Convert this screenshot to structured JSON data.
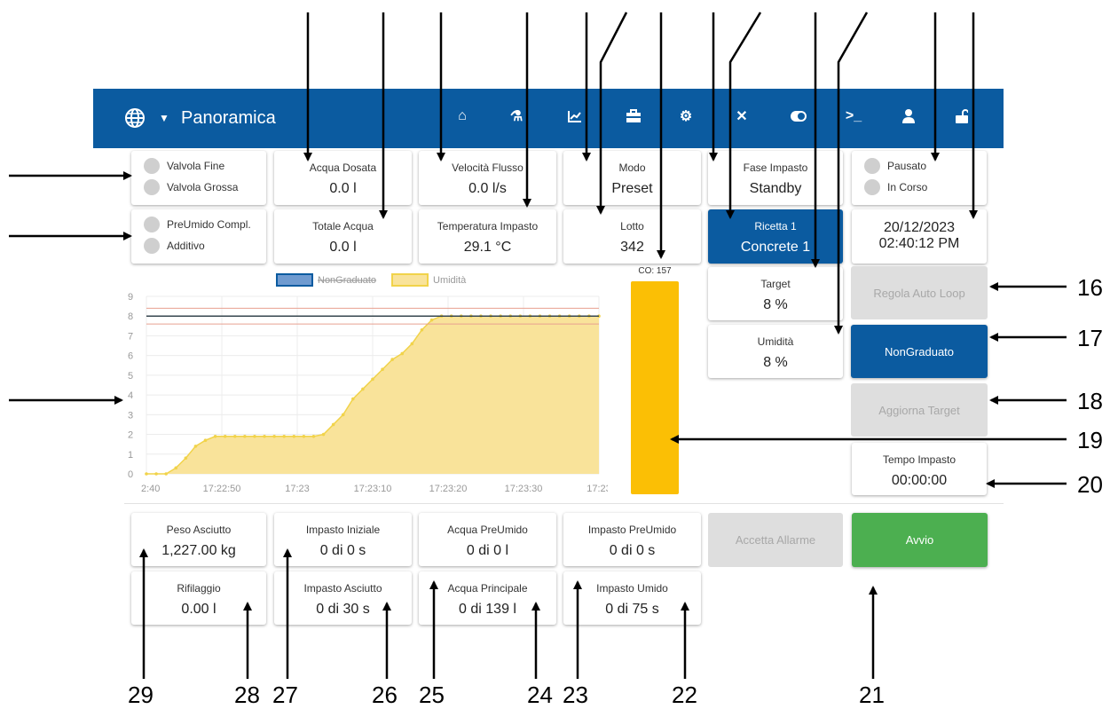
{
  "header": {
    "title": "Panoramica",
    "nav_icons": [
      "home-icon",
      "flask-icon",
      "chart-icon",
      "toolbox-icon",
      "gear-icon",
      "tools-icon",
      "toggle-icon",
      "terminal-icon",
      "user-icon",
      "unlock-icon"
    ]
  },
  "indicators": {
    "valvola_fine": "Valvola Fine",
    "valvola_grossa": "Valvola Grossa",
    "preumido_compl": "PreUmido Compl.",
    "additivo": "Additivo",
    "pausato": "Pausato",
    "in_corso": "In Corso"
  },
  "cards": {
    "acqua_dosata": {
      "label": "Acqua Dosata",
      "value": "0.0 l"
    },
    "velocita_flusso": {
      "label": "Velocità Flusso",
      "value": "0.0 l/s"
    },
    "modo": {
      "label": "Modo",
      "value": "Preset"
    },
    "fase_impasto": {
      "label": "Fase Impasto",
      "value": "Standby"
    },
    "totale_acqua": {
      "label": "Totale Acqua",
      "value": "0.0 l"
    },
    "temperatura": {
      "label": "Temperatura Impasto",
      "value": "29.1 °C"
    },
    "lotto": {
      "label": "Lotto",
      "value": "342"
    },
    "ricetta": {
      "label": "Ricetta 1",
      "value": "Concrete 1"
    },
    "datetime": {
      "date": "20/12/2023",
      "time": "02:40:12 PM"
    },
    "target": {
      "label": "Target",
      "value": "8 %"
    },
    "umidita": {
      "label": "Umidità",
      "value": "8 %"
    },
    "tempo_impasto": {
      "label": "Tempo Impasto",
      "value": "00:00:00"
    },
    "peso_asciutto": {
      "label": "Peso Asciutto",
      "value": "1,227.00 kg"
    },
    "rifilaggio": {
      "label": "Rifilaggio",
      "value": "0.00 l"
    },
    "impasto_iniziale": {
      "label": "Impasto Iniziale",
      "value": "0 di 0 s"
    },
    "impasto_asciutto": {
      "label": "Impasto Asciutto",
      "value": "0 di 30 s"
    },
    "acqua_preumido": {
      "label": "Acqua PreUmido",
      "value": "0 di 0 l"
    },
    "acqua_principale": {
      "label": "Acqua Principale",
      "value": "0 di 139 l"
    },
    "impasto_preumido": {
      "label": "Impasto PreUmido",
      "value": "0 di 0 s"
    },
    "impasto_umido": {
      "label": "Impasto Umido",
      "value": "0 di 75 s"
    }
  },
  "buttons": {
    "regola_auto_loop": "Regola Auto Loop",
    "nongraduato": "NonGraduato",
    "aggiorna_target": "Aggiorna Target",
    "accetta_allarme": "Accetta Allarme",
    "avvio": "Avvio"
  },
  "co_gauge": {
    "label": "CO: 157",
    "fill_fraction": 1.0,
    "color": "#fbbf05"
  },
  "callouts": [
    "16",
    "17",
    "18",
    "19",
    "20",
    "21",
    "22",
    "23",
    "24",
    "25",
    "26",
    "27",
    "28",
    "29"
  ],
  "colors": {
    "header": "#0b5ba0",
    "area_fill": "#f9e39a",
    "area_line": "#f1d34a",
    "target_line": "#37474f",
    "limit_line": "#e8a090",
    "green": "#4caf50"
  },
  "chart_data": {
    "type": "area",
    "legend": [
      "NonGraduato",
      "Umidità"
    ],
    "legend_placement": "top",
    "x_ticks": [
      "2:40",
      "17:22:50",
      "17:23",
      "17:23:10",
      "17:23:20",
      "17:23:30",
      "17:23"
    ],
    "y_ticks": [
      "0",
      "1",
      "2",
      "3",
      "4",
      "5",
      "6",
      "7",
      "8",
      "9"
    ],
    "ylim": [
      0,
      9
    ],
    "grid": true,
    "nongraduato_value": 8,
    "limit_lines": [
      7.6,
      8.4
    ],
    "series": [
      {
        "name": "Umidità",
        "values": [
          0,
          0,
          0,
          0.3,
          0.8,
          1.4,
          1.7,
          1.9,
          1.9,
          1.9,
          1.9,
          1.9,
          1.9,
          1.9,
          1.9,
          1.9,
          1.9,
          1.9,
          2.0,
          2.5,
          3.0,
          3.8,
          4.3,
          4.8,
          5.3,
          5.8,
          6.1,
          6.6,
          7.3,
          7.8,
          8,
          8,
          8,
          8,
          8,
          8,
          8,
          8,
          8,
          8,
          8,
          8,
          8,
          8,
          8,
          8,
          8
        ]
      }
    ]
  }
}
